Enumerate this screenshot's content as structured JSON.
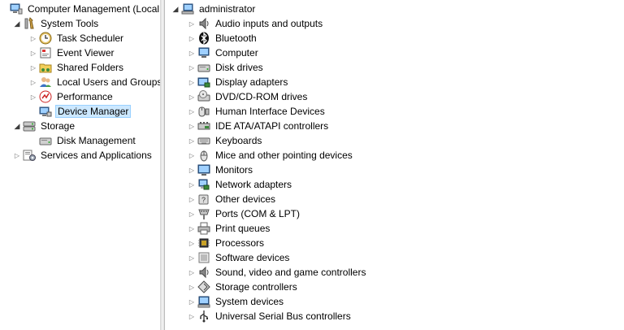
{
  "left_tree": {
    "root": {
      "label": "Computer Management (Local",
      "icon": "computer-management-icon"
    },
    "system_tools": {
      "label": "System Tools",
      "icon": "tools-icon"
    },
    "task_scheduler": {
      "label": "Task Scheduler",
      "icon": "clock-icon"
    },
    "event_viewer": {
      "label": "Event Viewer",
      "icon": "event-viewer-icon"
    },
    "shared_folders": {
      "label": "Shared Folders",
      "icon": "shared-folder-icon"
    },
    "local_users": {
      "label": "Local Users and Groups",
      "icon": "users-icon"
    },
    "performance": {
      "label": "Performance",
      "icon": "performance-icon"
    },
    "device_manager": {
      "label": "Device Manager",
      "icon": "device-manager-icon",
      "selected": true
    },
    "storage": {
      "label": "Storage",
      "icon": "storage-icon"
    },
    "disk_management": {
      "label": "Disk Management",
      "icon": "disk-icon"
    },
    "services": {
      "label": "Services and Applications",
      "icon": "services-icon"
    }
  },
  "right_tree": {
    "root": {
      "label": "administrator",
      "icon": "computer-icon"
    },
    "categories": [
      {
        "label": "Audio inputs and outputs",
        "icon": "speaker-icon"
      },
      {
        "label": "Bluetooth",
        "icon": "bluetooth-icon"
      },
      {
        "label": "Computer",
        "icon": "computer-icon"
      },
      {
        "label": "Disk drives",
        "icon": "disk-drive-icon"
      },
      {
        "label": "Display adapters",
        "icon": "display-adapter-icon"
      },
      {
        "label": "DVD/CD-ROM drives",
        "icon": "dvd-icon"
      },
      {
        "label": "Human Interface Devices",
        "icon": "hid-icon"
      },
      {
        "label": "IDE ATA/ATAPI controllers",
        "icon": "ide-controller-icon"
      },
      {
        "label": "Keyboards",
        "icon": "keyboard-icon"
      },
      {
        "label": "Mice and other pointing devices",
        "icon": "mouse-icon"
      },
      {
        "label": "Monitors",
        "icon": "monitor-icon"
      },
      {
        "label": "Network adapters",
        "icon": "network-adapter-icon"
      },
      {
        "label": "Other devices",
        "icon": "unknown-device-icon"
      },
      {
        "label": "Ports (COM & LPT)",
        "icon": "port-icon"
      },
      {
        "label": "Print queues",
        "icon": "printer-icon"
      },
      {
        "label": "Processors",
        "icon": "processor-icon"
      },
      {
        "label": "Software devices",
        "icon": "software-device-icon"
      },
      {
        "label": "Sound, video and game controllers",
        "icon": "sound-icon"
      },
      {
        "label": "Storage controllers",
        "icon": "storage-controller-icon"
      },
      {
        "label": "System devices",
        "icon": "system-device-icon"
      },
      {
        "label": "Universal Serial Bus controllers",
        "icon": "usb-icon"
      }
    ]
  },
  "colors": {
    "selection_bg": "#cce8ff",
    "selection_border": "#99d1ff",
    "pane_bg": "#ffffff",
    "chrome_bg": "#f0f0f0"
  }
}
